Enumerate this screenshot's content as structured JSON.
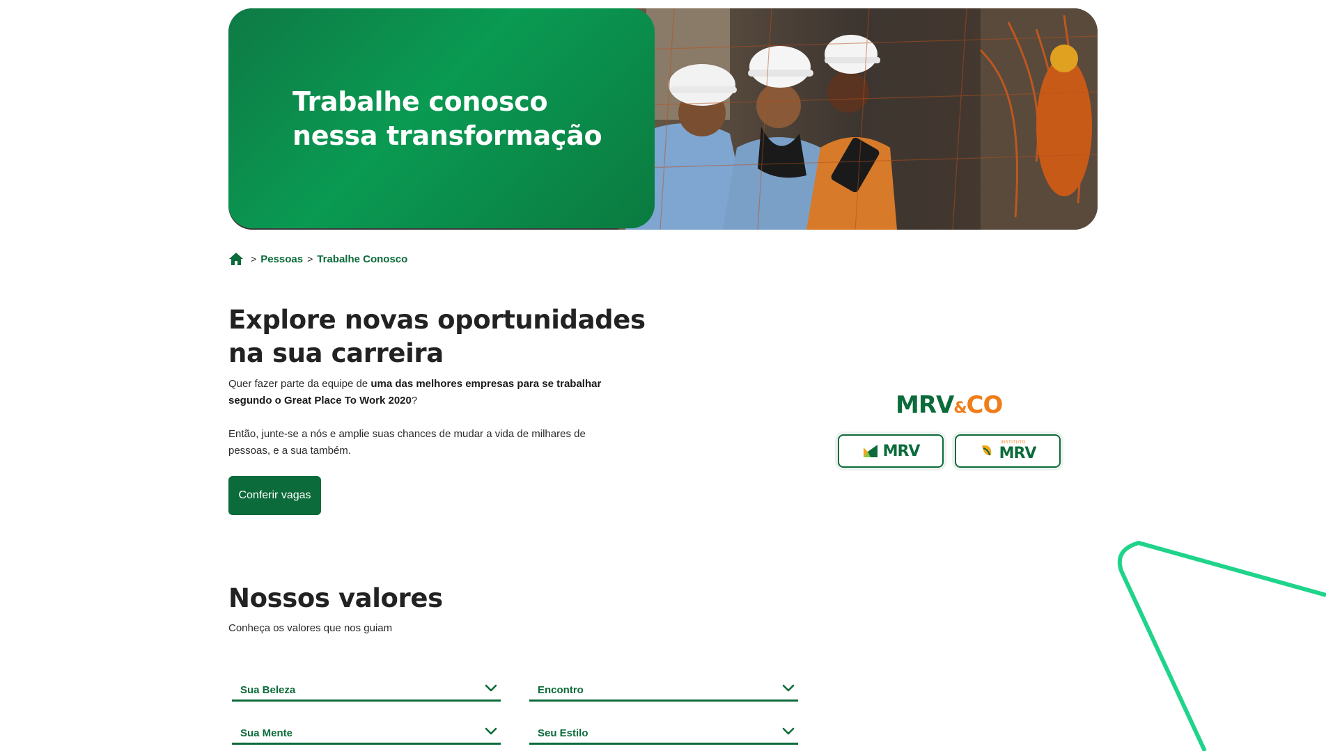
{
  "hero": {
    "title_line1": "Trabalhe conosco",
    "title_line2": "nessa transformação"
  },
  "breadcrumb": {
    "home_icon": "home-icon",
    "separator": ">",
    "items": [
      "Pessoas",
      "Trabalhe Conosco"
    ]
  },
  "intro": {
    "title_line1": "Explore novas oportunidades",
    "title_line2": "na sua carreira",
    "text1_prefix": "Quer fazer parte da equipe de ",
    "text1_bold": "uma das melhores empresas para se trabalhar segundo o Great Place To Work 2020",
    "text1_suffix": "?",
    "text2": "Então, junte-se a nós e amplie suas chances de mudar a vida de milhares de pessoas, e a sua também.",
    "cta_label": "Conferir vagas"
  },
  "logos": {
    "main_mrv": "MRV",
    "main_amp": "&",
    "main_co": "CO",
    "box_a": "MRV",
    "box_b_small": "INSTITUTO",
    "box_b": "MRV"
  },
  "values": {
    "title": "Nossos valores",
    "subtitle": "Conheça os valores que nos guiam",
    "items": [
      "Sua Beleza",
      "Encontro",
      "Sua Mente",
      "Seu Estilo"
    ]
  },
  "colors": {
    "brand_green": "#0b6b3a",
    "hero_green": "#0a9a52",
    "accent_orange": "#f07d1a",
    "deco_line": "#1fd48a"
  }
}
